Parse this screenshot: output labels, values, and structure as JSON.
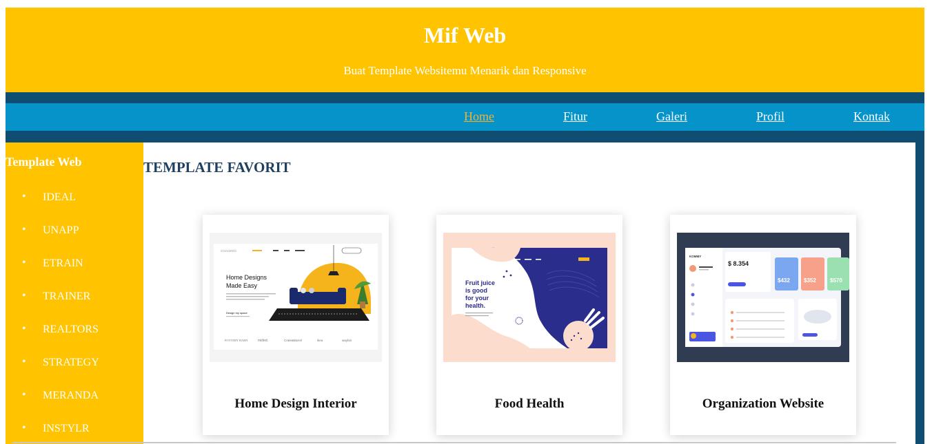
{
  "header": {
    "title": "Mif Web",
    "subtitle": "Buat Template Websitemu Menarik dan Responsive"
  },
  "nav": {
    "items": [
      {
        "label": "Home"
      },
      {
        "label": "Fitur"
      },
      {
        "label": "Galeri"
      },
      {
        "label": "Profil"
      },
      {
        "label": "Kontak"
      }
    ]
  },
  "sidebar": {
    "title": "Template Web",
    "bullet": "•",
    "items": [
      "IDEAL",
      "UNAPP",
      "ETRAIN",
      "TRAINER",
      "REALTORS",
      "STRATEGY",
      "MERANDA",
      "INSTYLR"
    ]
  },
  "main": {
    "heading": "TEMPLATE FAVORIT",
    "cards": [
      {
        "title": "Home Design Interior",
        "thumb": {
          "brand": "COACEDO",
          "headline_1": "Home Designs",
          "headline_2": "Made Easy",
          "cta": "Design my space",
          "logos": [
            "POTTERY BARN",
            "mided.",
            "Crate&Barrel",
            "ikea",
            "wayfair"
          ]
        }
      },
      {
        "title": "Food Health",
        "thumb": {
          "headline_1": "Fruit juice",
          "headline_2": "is good",
          "headline_3": "for your",
          "headline_4": "health."
        }
      },
      {
        "title": "Organization Website",
        "thumb": {
          "brand": "KOMMY",
          "balance": "$ 8.354",
          "stats": [
            "$432",
            "$352",
            "$570"
          ]
        }
      }
    ]
  },
  "colors": {
    "header_bg": "#ffc300",
    "page_border": "#0f4d73",
    "nav_bg": "#0593c9",
    "nav_active": "#f2b233",
    "heading": "#1f4060"
  }
}
